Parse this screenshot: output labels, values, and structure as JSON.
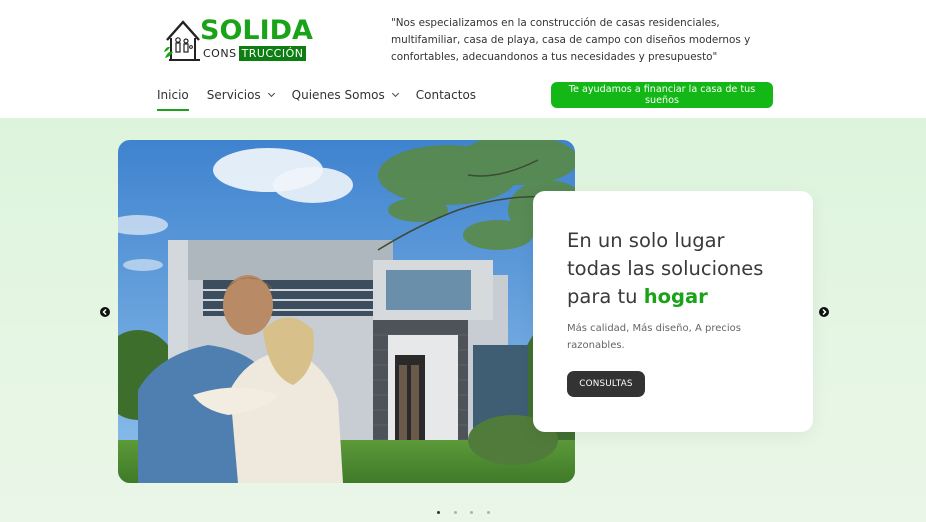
{
  "brand": {
    "name_main": "SOLIDA",
    "name_sub_a": "CONS",
    "name_sub_b": "TRUCCIÓN",
    "primary_color": "#1aa319",
    "dark_green": "#0e7d12"
  },
  "header": {
    "tagline": "\"Nos especializamos en la construcción de casas residenciales, multifamiliar, casa de playa, casa de campo con diseños modernos y confortables, adecuandonos a tus necesidades y presupuesto\""
  },
  "nav": {
    "items": [
      {
        "label": "Inicio",
        "active": true,
        "has_dropdown": false
      },
      {
        "label": "Servicios",
        "active": false,
        "has_dropdown": true
      },
      {
        "label": "Quienes Somos",
        "active": false,
        "has_dropdown": true
      },
      {
        "label": "Contactos",
        "active": false,
        "has_dropdown": false
      }
    ],
    "cta_label": "Te ayudamos a financiar la casa de tus sueños",
    "cta_color": "#13b816"
  },
  "hero": {
    "title_line1": "En un solo lugar",
    "title_line2": "todas las soluciones",
    "title_line3_prefix": "para tu ",
    "title_highlight": "hogar",
    "subtitle": "Más calidad, Más diseño, A precios razonables.",
    "button_label": "CONSULTAS",
    "image_icon": "house-couple-photo",
    "prev_icon": "chevron-left-icon",
    "next_icon": "chevron-right-icon",
    "slides_total": 4,
    "slide_active": 1
  }
}
